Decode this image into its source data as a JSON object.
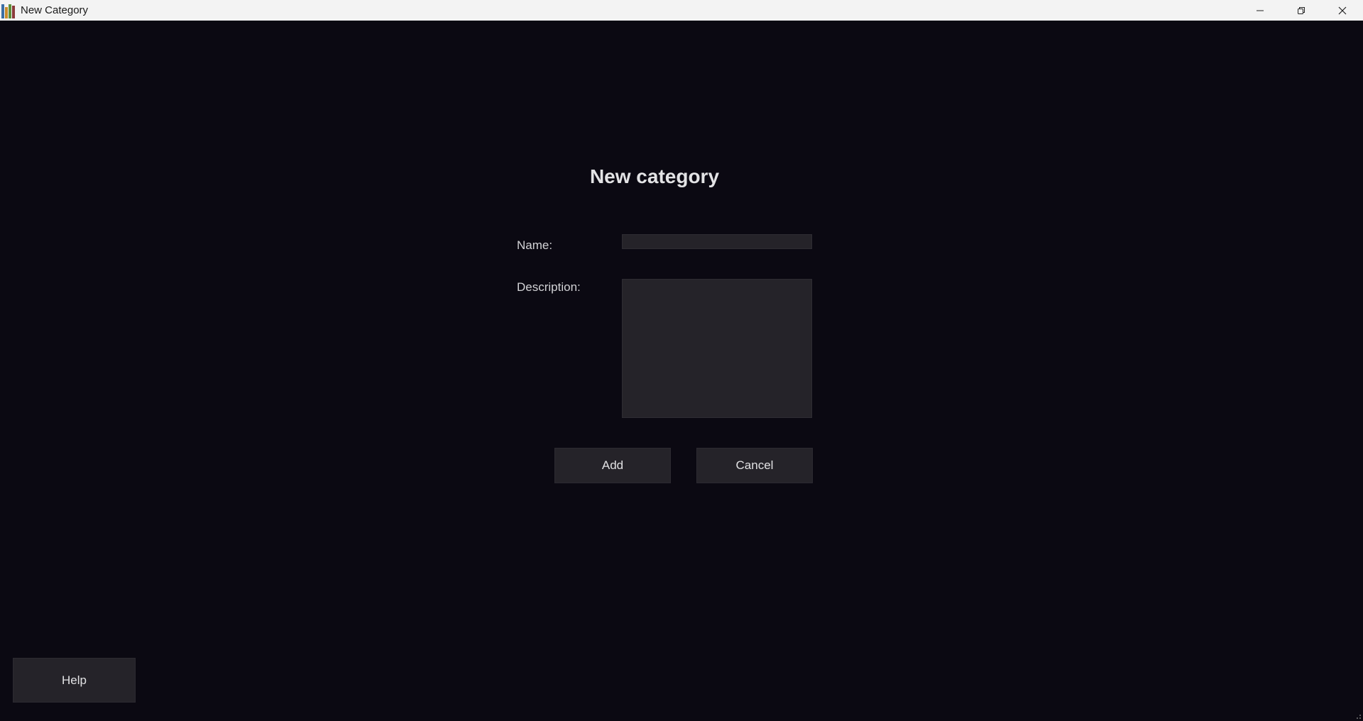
{
  "window": {
    "title": "New Category",
    "controls": {
      "minimize_icon": "minimize-icon",
      "restore_icon": "restore-icon",
      "close_icon": "close-icon"
    }
  },
  "form": {
    "heading": "New category",
    "name_label": "Name:",
    "name_value": "",
    "description_label": "Description:",
    "description_value": "",
    "add_label": "Add",
    "cancel_label": "Cancel"
  },
  "help_label": "Help",
  "colors": {
    "background": "#0b0912",
    "control": "#252329",
    "text": "#e3e3e5",
    "titlebar": "#f3f3f3"
  }
}
